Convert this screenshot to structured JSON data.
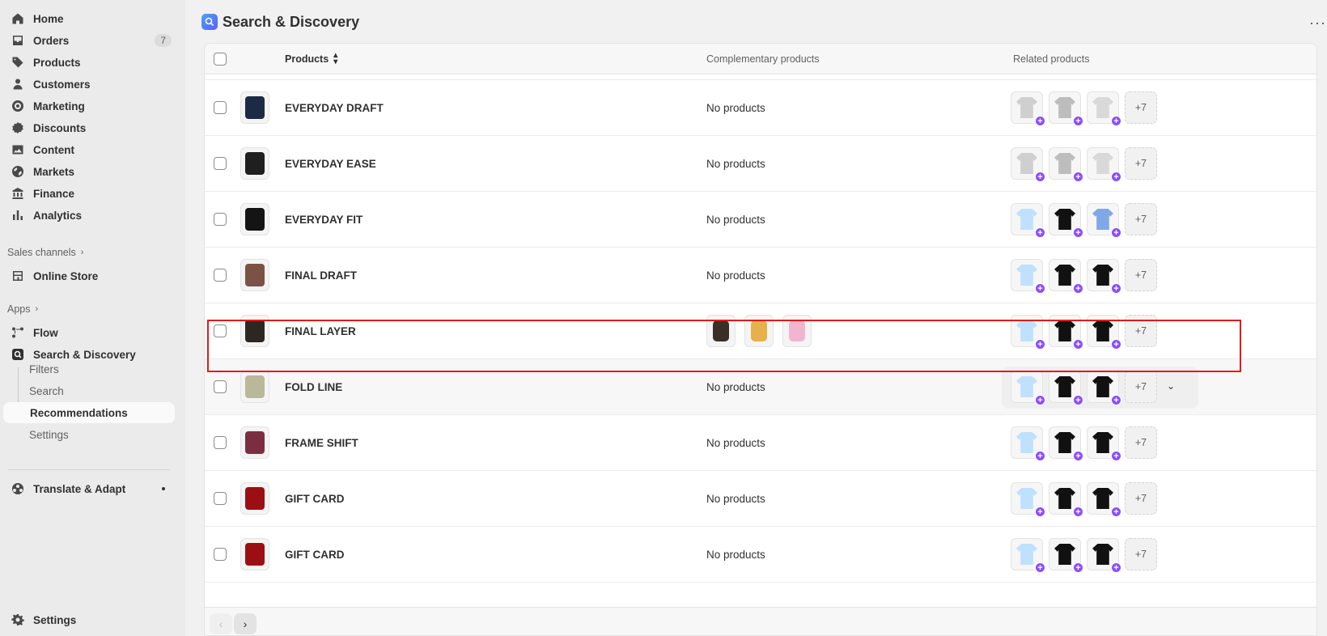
{
  "sidebar": {
    "nav": [
      {
        "label": "Home",
        "icon": "home-icon"
      },
      {
        "label": "Orders",
        "icon": "inbox-icon",
        "count": "7"
      },
      {
        "label": "Products",
        "icon": "tag-icon"
      },
      {
        "label": "Customers",
        "icon": "person-icon"
      },
      {
        "label": "Marketing",
        "icon": "target-icon"
      },
      {
        "label": "Discounts",
        "icon": "discount-icon"
      },
      {
        "label": "Content",
        "icon": "image-icon"
      },
      {
        "label": "Markets",
        "icon": "globe-icon"
      },
      {
        "label": "Finance",
        "icon": "bank-icon"
      },
      {
        "label": "Analytics",
        "icon": "chart-icon"
      }
    ],
    "sales_channels_label": "Sales channels",
    "online_store": "Online Store",
    "apps_label": "Apps",
    "flow": "Flow",
    "search_discovery": "Search & Discovery",
    "sub_items": [
      "Filters",
      "Search",
      "Recommendations",
      "Settings"
    ],
    "translate": "Translate & Adapt",
    "settings": "Settings"
  },
  "header": {
    "title": "Search & Discovery",
    "more": "···"
  },
  "table": {
    "col_products": "Products",
    "col_complementary": "Complementary products",
    "col_related": "Related products",
    "rows": [
      {
        "name": "EVERYDAY DRAFT",
        "complementary": "No products",
        "more": "+7"
      },
      {
        "name": "EVERYDAY EASE",
        "complementary": "No products",
        "more": "+7"
      },
      {
        "name": "EVERYDAY FIT",
        "complementary": "No products",
        "more": "+7"
      },
      {
        "name": "FINAL DRAFT",
        "complementary": "No products",
        "more": "+7"
      },
      {
        "name": "FINAL LAYER",
        "complementary": "",
        "more": "+7"
      },
      {
        "name": "FOLD LINE",
        "complementary": "No products",
        "more": "+7"
      },
      {
        "name": "FRAME SHIFT",
        "complementary": "No products",
        "more": "+7"
      },
      {
        "name": "GIFT CARD",
        "complementary": "No products",
        "more": "+7"
      },
      {
        "name": "GIFT CARD",
        "complementary": "No products",
        "more": "+7"
      }
    ]
  },
  "colors": {
    "highlight": "#e01b1b",
    "badge": "#8a4dff",
    "sidebar_bg": "#ebebeb"
  }
}
